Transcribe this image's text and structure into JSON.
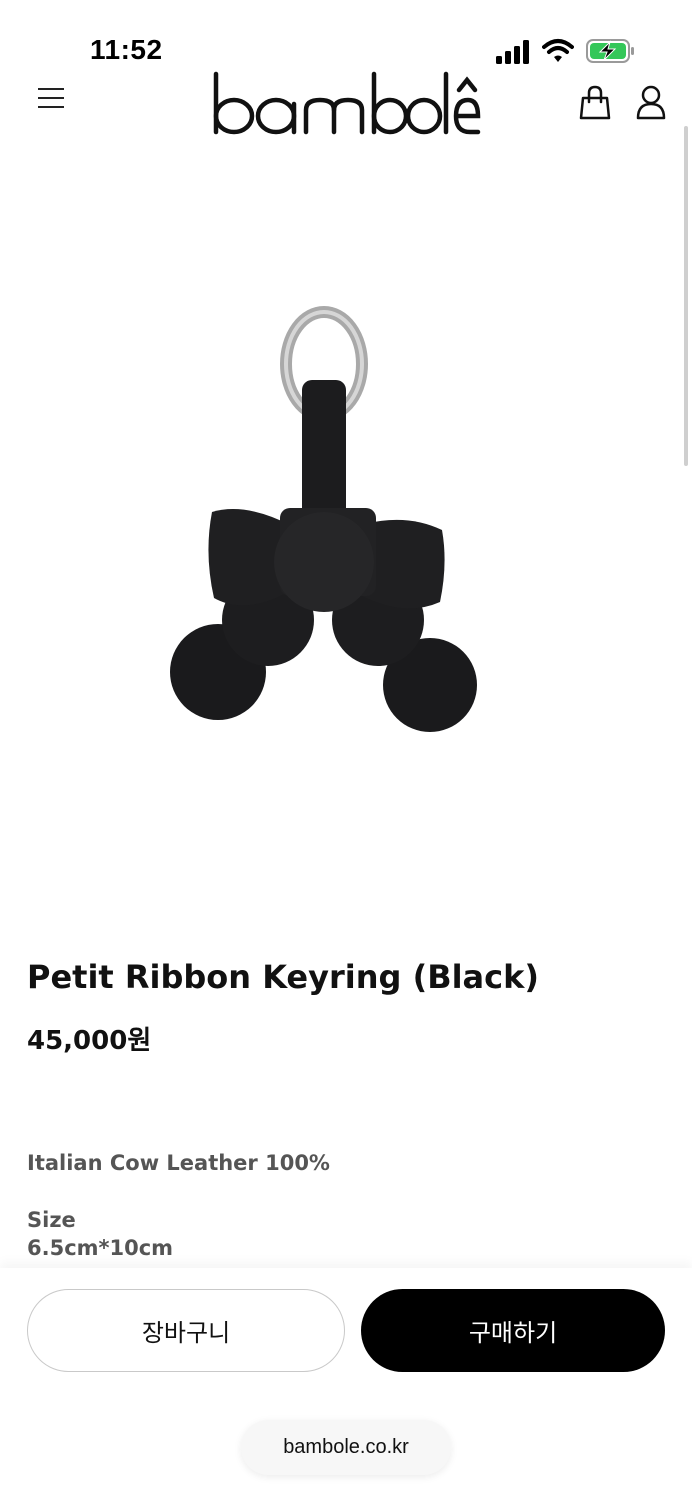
{
  "status_bar": {
    "time": "11:52",
    "icons": [
      "cellular-signal-icon",
      "wifi-icon",
      "battery-charging-icon"
    ],
    "battery_color": "#34c759"
  },
  "header": {
    "logo_text": "bamboleˆ",
    "icons": [
      "hamburger-menu-icon",
      "shopping-bag-icon",
      "user-icon"
    ]
  },
  "product": {
    "title": "Petit Ribbon Keyring (Black)",
    "price": "45,000원",
    "material": "Italian Cow Leather 100%",
    "size_label": "Size",
    "size_value": "6.5cm*10cm"
  },
  "actions": {
    "cart_label": "장바구니",
    "buy_label": "구매하기"
  },
  "browser": {
    "url": "bambole.co.kr"
  },
  "colors": {
    "primary": "#000000",
    "text": "#111111",
    "secondary_text": "#555555",
    "border": "#c9c9c9"
  }
}
